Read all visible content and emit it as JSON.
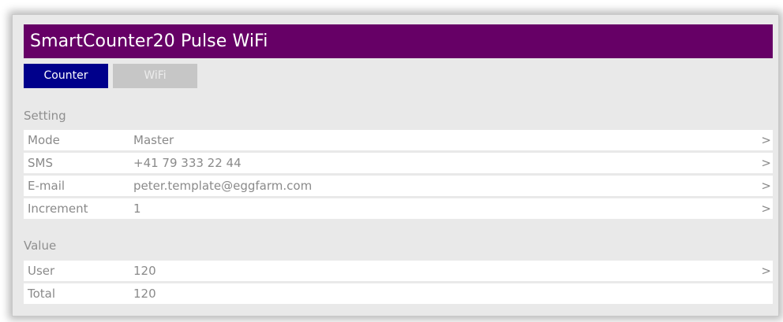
{
  "app": {
    "title": "SmartCounter20 Pulse WiFi"
  },
  "tabs": [
    {
      "label": "Counter",
      "active": true
    },
    {
      "label": "WiFi",
      "active": false
    }
  ],
  "setting": {
    "heading": "Setting",
    "rows": [
      {
        "label": "Mode",
        "value": "Master",
        "chevron": ">"
      },
      {
        "label": "SMS",
        "value": "+41 79 333 22 44",
        "chevron": ">"
      },
      {
        "label": "E-mail",
        "value": "peter.template@eggfarm.com",
        "chevron": ">"
      },
      {
        "label": "Increment",
        "value": "1",
        "chevron": ">"
      }
    ]
  },
  "value_section": {
    "heading": "Value",
    "rows": [
      {
        "label": "User",
        "value": "120",
        "chevron": ">"
      },
      {
        "label": "Total",
        "value": "120",
        "chevron": ""
      }
    ]
  },
  "colors": {
    "title_bar": "#660066",
    "active_tab": "#00008b",
    "inactive_tab": "#c6c6c6"
  }
}
